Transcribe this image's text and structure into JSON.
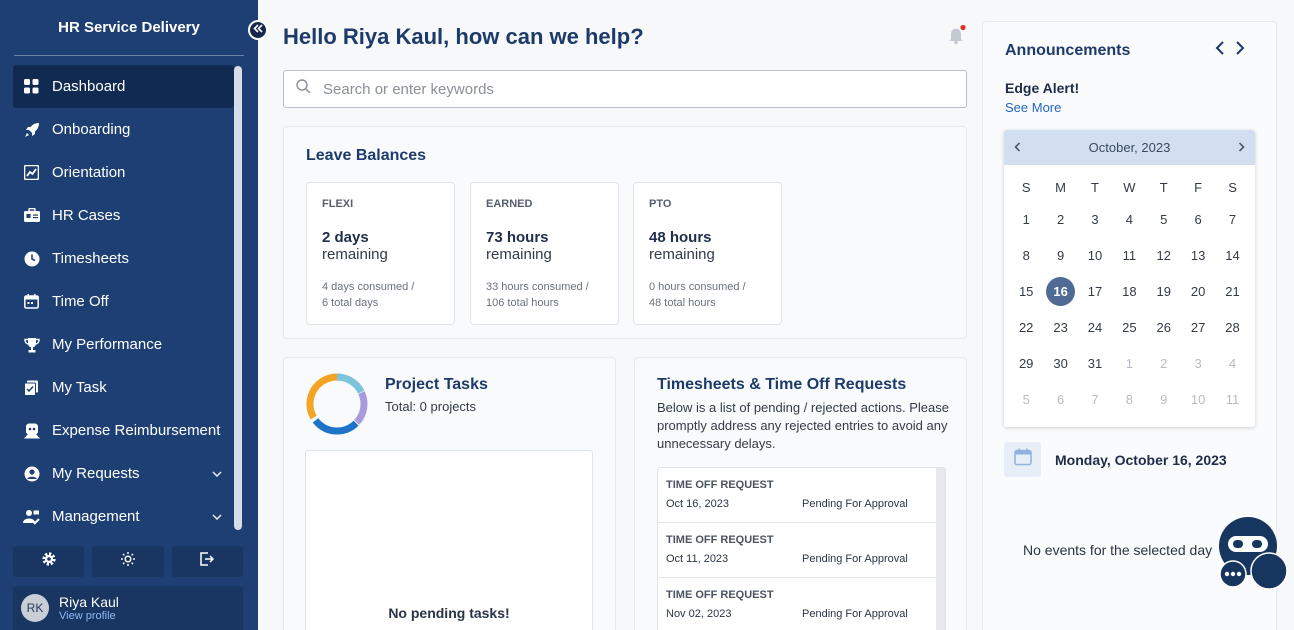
{
  "sidebar": {
    "brand": "HR Service Delivery",
    "items": [
      {
        "label": "Dashboard",
        "icon": "dashboard-icon",
        "active": true
      },
      {
        "label": "Onboarding",
        "icon": "rocket-icon"
      },
      {
        "label": "Orientation",
        "icon": "chart-icon"
      },
      {
        "label": "HR Cases",
        "icon": "cases-icon"
      },
      {
        "label": "Timesheets",
        "icon": "clock-icon"
      },
      {
        "label": "Time Off",
        "icon": "calendar-icon"
      },
      {
        "label": "My Performance",
        "icon": "trophy-icon"
      },
      {
        "label": "My Task",
        "icon": "task-icon"
      },
      {
        "label": "Expense Reimbursement",
        "icon": "expense-icon"
      },
      {
        "label": "My Requests",
        "icon": "user-circle-icon",
        "expandable": true
      },
      {
        "label": "Management",
        "icon": "management-icon",
        "expandable": true
      }
    ],
    "profile": {
      "initials": "RK",
      "name": "Riya Kaul",
      "link": "View profile"
    }
  },
  "header": {
    "greeting": "Hello Riya Kaul, how can we help?",
    "search_placeholder": "Search or enter keywords"
  },
  "leave": {
    "title": "Leave Balances",
    "balances": [
      {
        "type": "FLEXI",
        "value": "2 days",
        "remaining": "remaining",
        "detail1": "4 days consumed /",
        "detail2": "6 total days"
      },
      {
        "type": "EARNED",
        "value": "73 hours",
        "remaining": "remaining",
        "detail1": "33 hours consumed /",
        "detail2": "106 total hours"
      },
      {
        "type": "PTO",
        "value": "48 hours",
        "remaining": "remaining",
        "detail1": "0 hours consumed /",
        "detail2": "48 total hours"
      }
    ]
  },
  "tasks": {
    "title": "Project Tasks",
    "total": "Total: 0 projects",
    "empty": "No pending tasks!"
  },
  "timesheets": {
    "title": "Timesheets & Time Off Requests",
    "desc": "Below is a list of pending / rejected actions. Please promptly address any rejected entries to avoid any unnecessary delays.",
    "rows": [
      {
        "type": "TIME OFF REQUEST",
        "date": "Oct 16, 2023",
        "status": "Pending For Approval"
      },
      {
        "type": "TIME OFF REQUEST",
        "date": "Oct 11, 2023",
        "status": "Pending For Approval"
      },
      {
        "type": "TIME OFF REQUEST",
        "date": "Nov 02, 2023",
        "status": "Pending For Approval"
      }
    ]
  },
  "announcements": {
    "title": "Announcements",
    "headline": "Edge Alert!",
    "see_more": "See More"
  },
  "calendar": {
    "month": "October, 2023",
    "dow": [
      "S",
      "M",
      "T",
      "W",
      "T",
      "F",
      "S"
    ],
    "days": [
      1,
      2,
      3,
      4,
      5,
      6,
      7,
      8,
      9,
      10,
      11,
      12,
      13,
      14,
      15,
      16,
      17,
      18,
      19,
      20,
      21,
      22,
      23,
      24,
      25,
      26,
      27,
      28,
      29,
      30,
      31
    ],
    "next_days": [
      1,
      2,
      3,
      4,
      5,
      6,
      7,
      8,
      9,
      10,
      11
    ],
    "selected": 16,
    "selected_label": "Monday, October 16, 2023",
    "no_events": "No events for the selected day"
  },
  "colors": {
    "sidebar": "#1e3f73",
    "accent": "#4f6a95",
    "notification": "#e0312b"
  }
}
